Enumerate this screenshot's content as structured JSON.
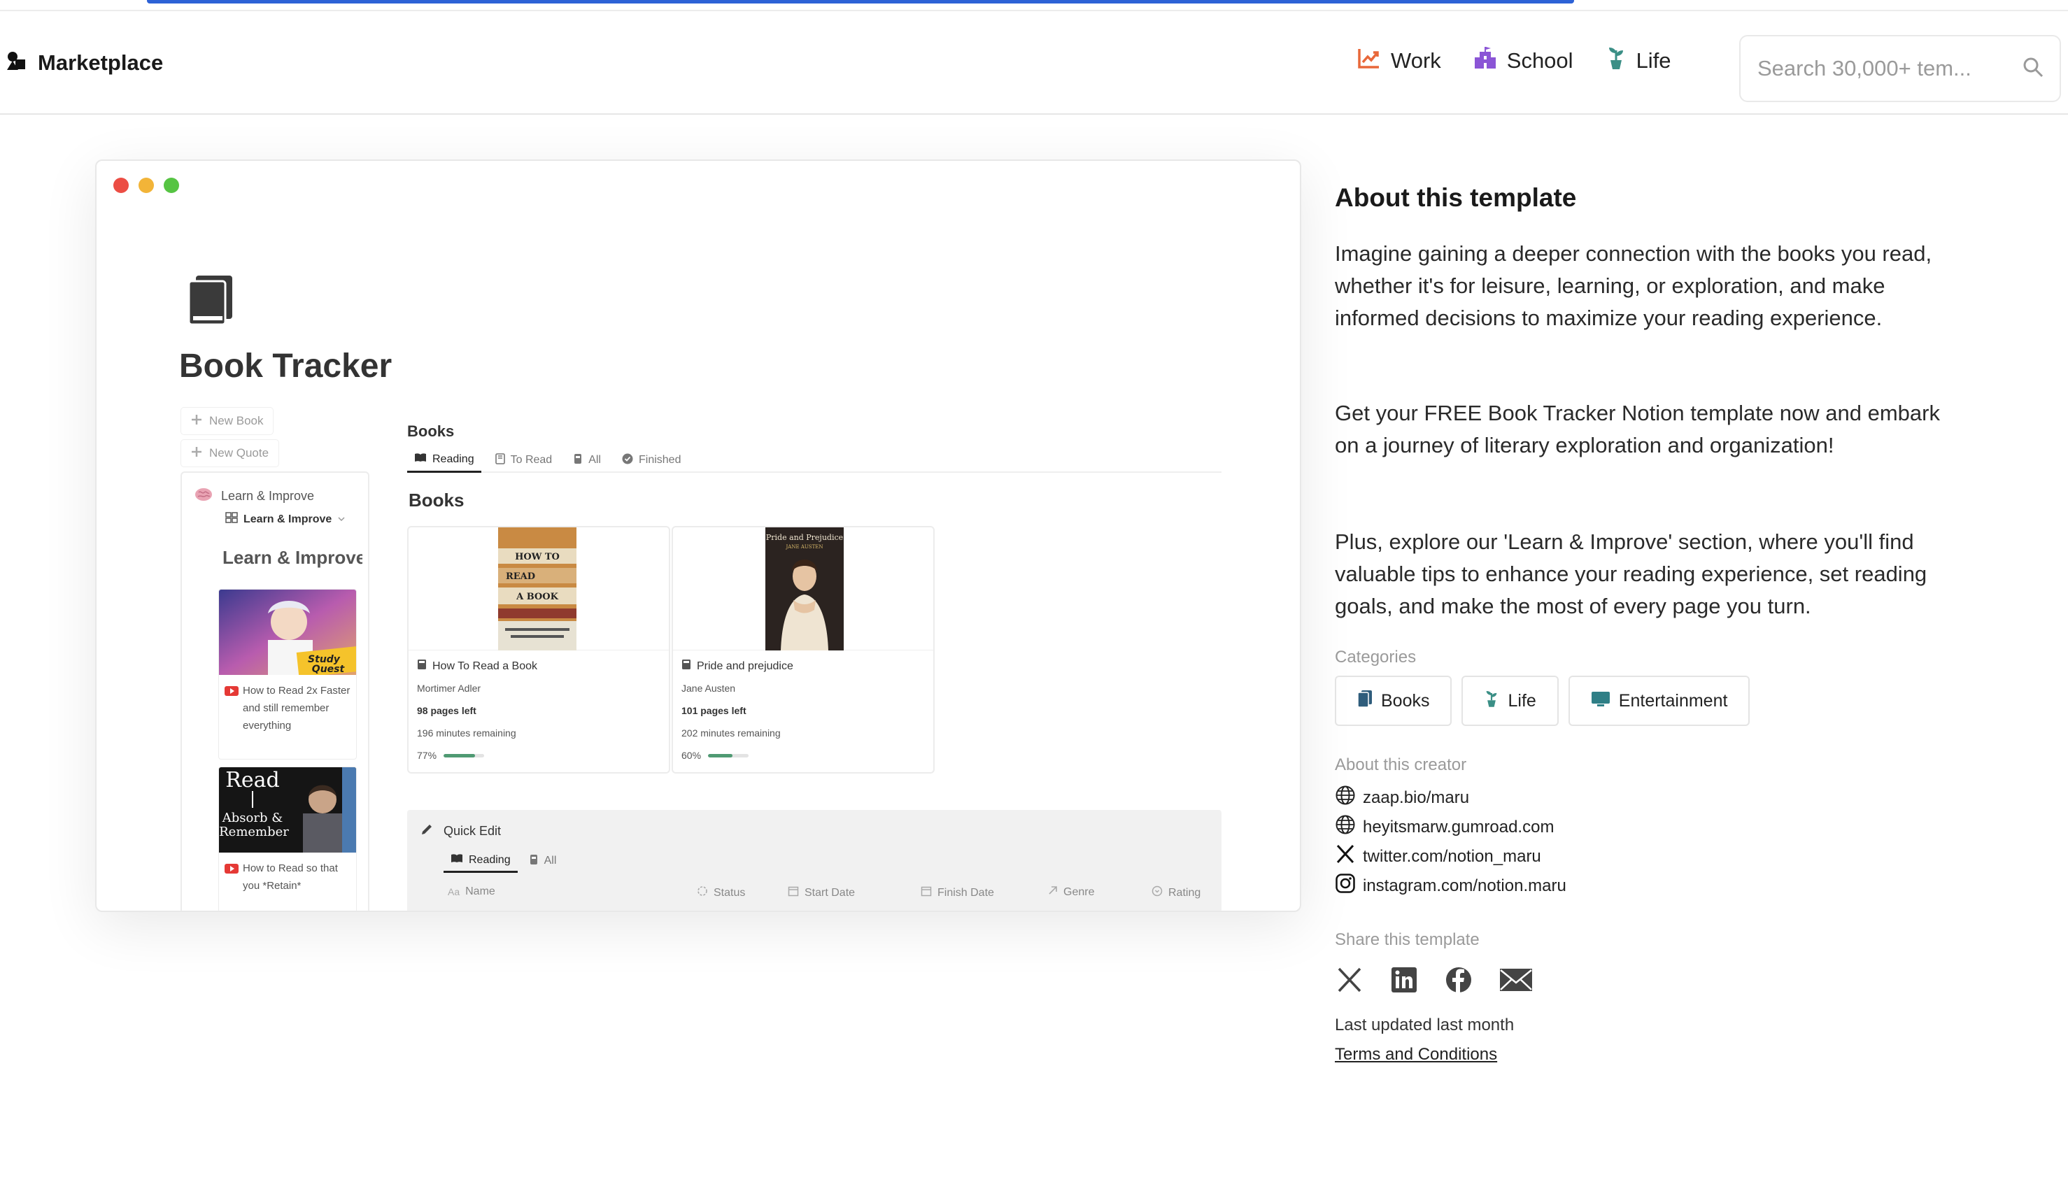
{
  "header": {
    "brand": "Marketplace",
    "nav": [
      {
        "label": "Work",
        "icon": "chart-icon",
        "color": "#e8683a"
      },
      {
        "label": "School",
        "icon": "school-icon",
        "color": "#8b55d6"
      },
      {
        "label": "Life",
        "icon": "plant-icon",
        "color": "#3b8f86"
      }
    ],
    "search_placeholder": "Search 30,000+ tem..."
  },
  "preview": {
    "page_title": "Book Tracker",
    "side_buttons": [
      "New Book",
      "New Quote"
    ],
    "learn_section": "Learn & Improve",
    "learn_view": "Learn & Improve",
    "learn_heading": "Learn & Improve",
    "videos": [
      {
        "title": "How to Read 2x Faster and still remember everything",
        "thumb_caption": "Study Quest"
      },
      {
        "title": "How to Read so that you *Retain*",
        "thumb_caption": "Read\nAbsorb &\nRemember"
      }
    ],
    "db_title": "Books",
    "tabs": [
      "Reading",
      "To Read",
      "All",
      "Finished"
    ],
    "books_heading": "Books",
    "books": [
      {
        "name": "How To Read a Book",
        "author": "Mortimer Adler",
        "pages_left": "98 pages left",
        "minutes": "196 minutes remaining",
        "progress_label": "77%",
        "progress": 0.77,
        "cover_lines": [
          "HOW TO",
          "READ",
          "A BOOK"
        ]
      },
      {
        "name": "Pride and prejudice",
        "author": "Jane Austen",
        "pages_left": "101 pages left",
        "minutes": "202 minutes remaining",
        "progress_label": "60%",
        "progress": 0.6,
        "cover_lines": [
          "Pride and Prejudice",
          "JANE AUSTEN"
        ]
      }
    ],
    "quick_edit": {
      "title": "Quick Edit",
      "tabs": [
        "Reading",
        "All"
      ],
      "columns": [
        "Name",
        "Status",
        "Start Date",
        "Finish Date",
        "Genre",
        "Rating"
      ]
    }
  },
  "about": {
    "title": "About this template",
    "paragraphs": [
      "Imagine gaining a deeper connection with the books you read, whether it's for leisure, learning, or exploration, and make informed decisions to maximize your reading experience.",
      "Get your FREE Book Tracker Notion template now and embark on a journey of literary exploration and organization!",
      "Plus, explore our 'Learn & Improve' section, where you'll find valuable tips to enhance your reading experience, set reading goals, and make the most of every page you turn."
    ]
  },
  "categories": {
    "label": "Categories",
    "items": [
      {
        "label": "Books",
        "icon": "book-icon"
      },
      {
        "label": "Life",
        "icon": "plant-icon"
      },
      {
        "label": "Entertainment",
        "icon": "tv-icon"
      }
    ]
  },
  "creator": {
    "label": "About this creator",
    "links": [
      {
        "text": "zaap.bio/maru",
        "icon": "globe-icon"
      },
      {
        "text": "heyitsmarw.gumroad.com",
        "icon": "globe-icon"
      },
      {
        "text": "twitter.com/notion_maru",
        "icon": "x-icon"
      },
      {
        "text": "instagram.com/notion.maru",
        "icon": "instagram-icon"
      }
    ]
  },
  "share": {
    "label": "Share this template",
    "targets": [
      "x-icon",
      "linkedin-icon",
      "facebook-icon",
      "mail-icon"
    ]
  },
  "footer": {
    "updated": "Last updated last month",
    "terms": "Terms and Conditions"
  }
}
